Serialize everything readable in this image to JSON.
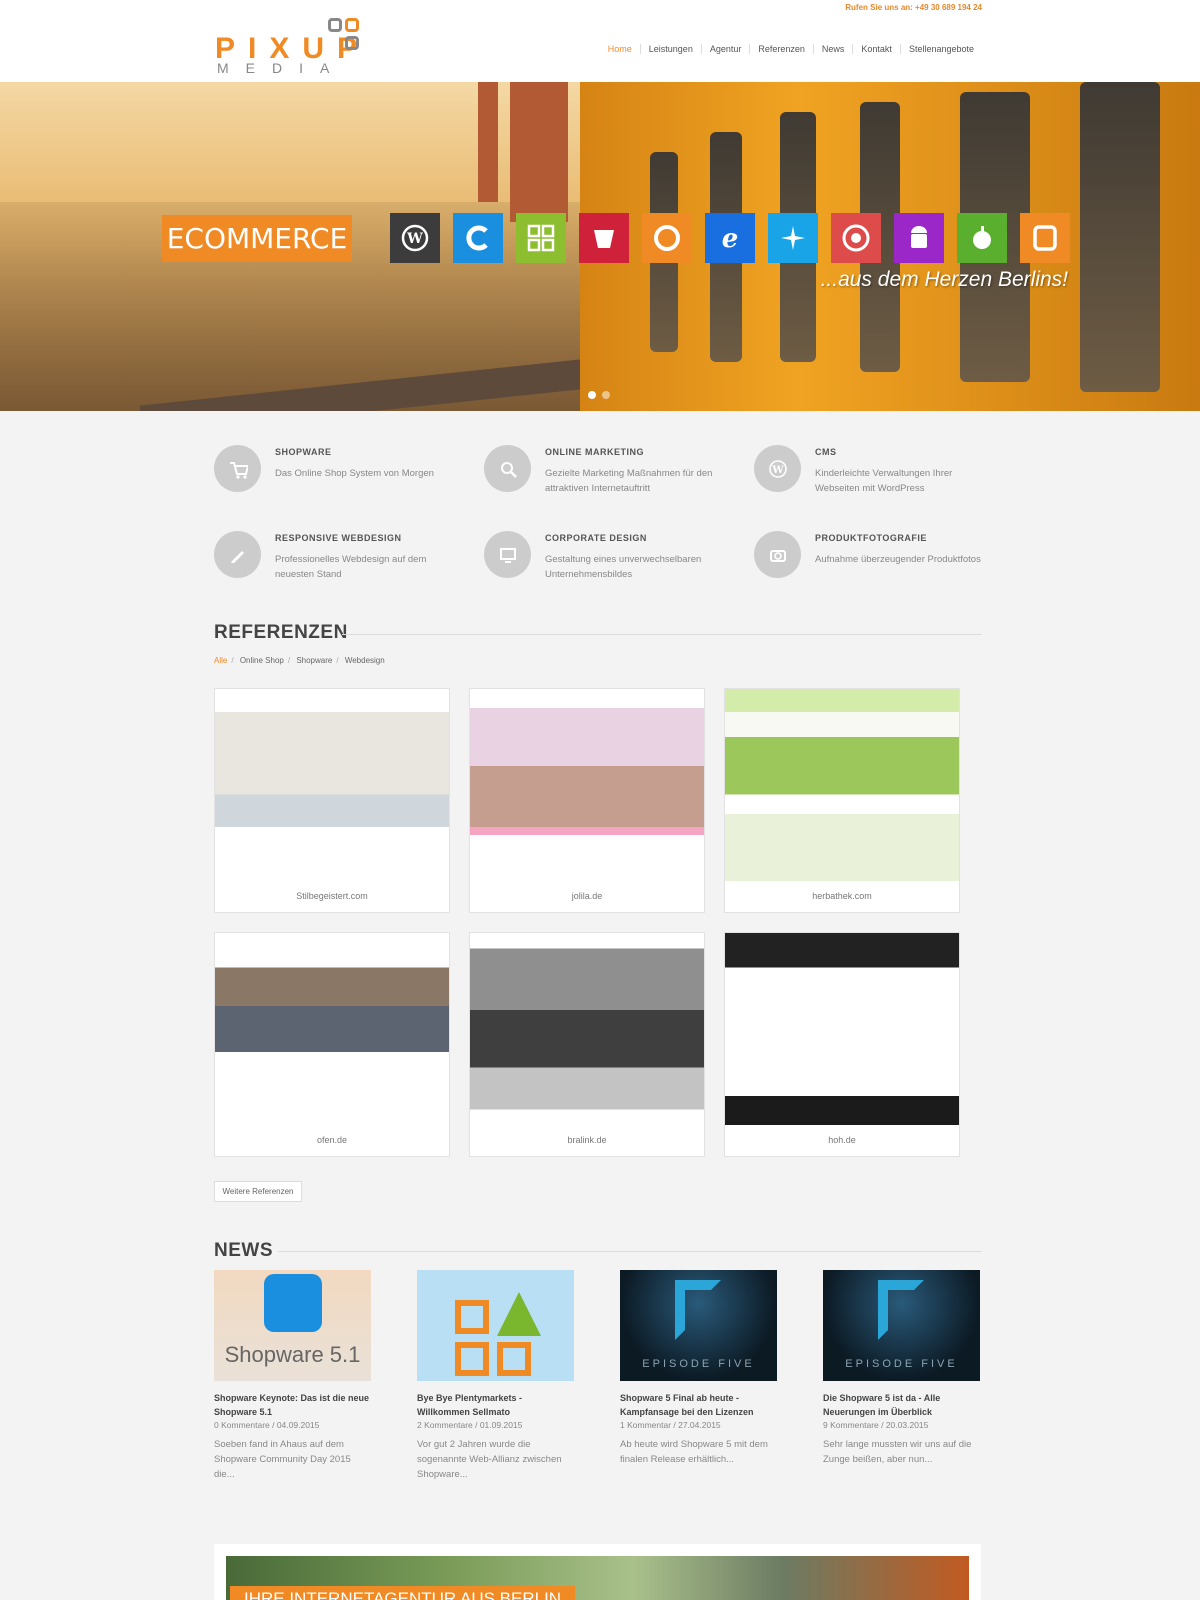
{
  "header": {
    "phone": "Rufen Sie uns an: +49 30 689 194 24",
    "logo_top": "PIXUP",
    "logo_bottom": "MEDIA",
    "nav": [
      "Home",
      "Leistungen",
      "Agentur",
      "Referenzen",
      "News",
      "Kontakt",
      "Stellenangebote"
    ]
  },
  "hero": {
    "badge": "ECOMMERCE",
    "tagline": "...aus dem Herzen Berlins!",
    "tiles": [
      {
        "icon": "wordpress-icon",
        "color": "#3c3c3c"
      },
      {
        "icon": "shopware-icon",
        "color": "#1a8fe0"
      },
      {
        "icon": "grid-icon",
        "color": "#8cbe2f"
      },
      {
        "icon": "gulp-icon",
        "color": "#d0213a"
      },
      {
        "icon": "firefox-icon",
        "color": "#f08a24"
      },
      {
        "icon": "ie-icon",
        "color": "#1a6fe0"
      },
      {
        "icon": "safari-icon",
        "color": "#1aa4e8"
      },
      {
        "icon": "chrome-icon",
        "color": "#dd4b4b"
      },
      {
        "icon": "android-icon",
        "color": "#9b27c9"
      },
      {
        "icon": "apple-icon",
        "color": "#5ab02e"
      },
      {
        "icon": "tablet-icon",
        "color": "#f08a24"
      }
    ]
  },
  "services": [
    {
      "title": "SHOPWARE",
      "text": "Das Online Shop System von Morgen",
      "icon": "cart-icon"
    },
    {
      "title": "ONLINE MARKETING",
      "text": "Gezielte Marketing Maßnahmen für den attraktiven Internetauftritt",
      "icon": "search-icon"
    },
    {
      "title": "CMS",
      "text": "Kinderleichte Verwaltungen Ihrer Webseiten mit WordPress",
      "icon": "wordpress-icon"
    },
    {
      "title": "RESPONSIVE WEBDESIGN",
      "text": "Professionelles Webdesign auf dem neuesten Stand",
      "icon": "pencil-icon"
    },
    {
      "title": "CORPORATE DESIGN",
      "text": "Gestaltung eines unverwechselbaren Unternehmensbildes",
      "icon": "monitor-icon"
    },
    {
      "title": "PRODUKTFOTOGRAFIE",
      "text": "Aufnahme überzeugender Produktfotos",
      "icon": "camera-icon"
    }
  ],
  "referenzen": {
    "title": "REFERENZEN",
    "filters": [
      "Alle",
      "Online Shop",
      "Shopware",
      "Webdesign"
    ],
    "items": [
      {
        "name": "Stilbegeistert.com",
        "theme": "light"
      },
      {
        "name": "jolila.de",
        "theme": "pink"
      },
      {
        "name": "herbathek.com",
        "theme": "green"
      },
      {
        "name": "ofen.de",
        "theme": "white"
      },
      {
        "name": "bralink.de",
        "theme": "gray"
      },
      {
        "name": "hoh.de",
        "theme": "dark"
      }
    ],
    "more_button": "Weitere Referenzen"
  },
  "news": {
    "title": "NEWS",
    "items": [
      {
        "title": "Shopware Keynote: Das ist die neue Shopware 5.1",
        "meta": "0 Kommentare / 04.09.2015",
        "text": "Soeben fand in Ahaus auf dem Shopware Community Day 2015 die...",
        "thumb_text": "Shopware 5.1"
      },
      {
        "title": "Bye Bye Plentymarkets - Willkommen Sellmato",
        "meta": "2 Kommentare / 01.09.2015",
        "text": "Vor gut 2 Jahren wurde die sogenannte Web-Allianz zwischen Shopware...",
        "thumb_text": ""
      },
      {
        "title": "Shopware 5 Final ab heute - Kampfansage bei den Lizenzen",
        "meta": "1 Kommentar / 27.04.2015",
        "text": "Ab heute wird Shopware 5 mit dem finalen Release erhältlich...",
        "thumb_text": "EPISODE FIVE"
      },
      {
        "title": "Die Shopware 5 ist da - Alle Neuerungen im Überblick",
        "meta": "9 Kommentare / 20.03.2015",
        "text": "Sehr lange mussten wir uns auf die Zunge beißen, aber nun...",
        "thumb_text": "EPISODE FIVE"
      }
    ]
  },
  "bottom_banner": {
    "label": "IHRE INTERNETAGENTUR AUS BERLIN"
  },
  "colors": {
    "accent": "#f08a24",
    "background": "#f3f3f3"
  }
}
